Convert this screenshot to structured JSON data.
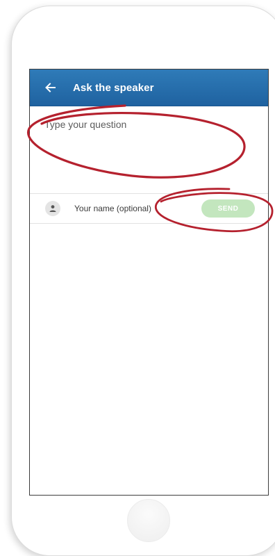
{
  "header": {
    "title": "Ask the speaker"
  },
  "question": {
    "placeholder": "Type your question"
  },
  "name": {
    "placeholder": "Your name (optional)"
  },
  "actions": {
    "send_label": "SEND"
  },
  "colors": {
    "appbar": "#2a72b0",
    "send_disabled": "#c3e6be",
    "annotation": "#b5212e"
  },
  "icons": {
    "back": "arrow-left-icon",
    "person": "person-icon"
  }
}
